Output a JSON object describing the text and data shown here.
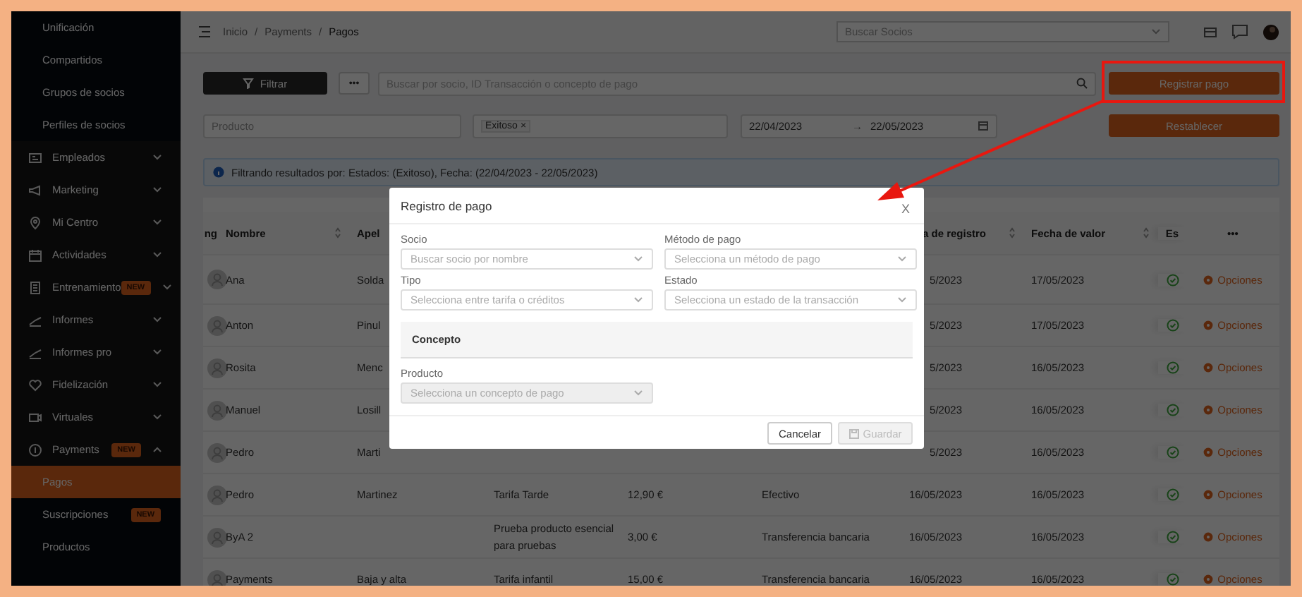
{
  "sidebar": {
    "items": [
      {
        "kind": "subitem",
        "label": "Unificación",
        "selected": false
      },
      {
        "kind": "subitem",
        "label": "Compartidos",
        "selected": false
      },
      {
        "kind": "subitem",
        "label": "Grupos de socios",
        "selected": false
      },
      {
        "kind": "subitem",
        "label": "Perfiles de socios",
        "selected": false
      },
      {
        "kind": "section",
        "label": "Empleados",
        "expanded": false
      },
      {
        "kind": "section",
        "label": "Marketing",
        "expanded": false
      },
      {
        "kind": "section",
        "label": "Mi Centro",
        "expanded": false
      },
      {
        "kind": "section",
        "label": "Actividades",
        "expanded": false
      },
      {
        "kind": "section",
        "label": "Entrenamiento",
        "badge": "NEW",
        "expanded": false
      },
      {
        "kind": "section",
        "label": "Informes",
        "expanded": false
      },
      {
        "kind": "section",
        "label": "Informes pro",
        "expanded": false
      },
      {
        "kind": "section",
        "label": "Fidelización",
        "expanded": false
      },
      {
        "kind": "section",
        "label": "Virtuales",
        "expanded": false
      },
      {
        "kind": "section",
        "label": "Payments",
        "badge": "NEW",
        "expanded": true,
        "children": [
          {
            "kind": "subitem",
            "label": "Pagos",
            "selected": true
          },
          {
            "kind": "subitem",
            "label": "Suscripciones",
            "badge": "NEW",
            "selected": false
          },
          {
            "kind": "subitem",
            "label": "Productos",
            "selected": false
          }
        ]
      }
    ]
  },
  "topbar": {
    "breadcrumb": [
      "Inicio",
      "/",
      "Payments",
      "/",
      "Pagos"
    ],
    "member_search": {
      "placeholder": "Buscar Socios"
    }
  },
  "toolbar": {
    "filter_button": "Filtrar",
    "more_button": "•••",
    "search": {
      "placeholder": "Buscar por socio, ID Transacción o concepto de pago"
    },
    "register_button": "Registrar pago"
  },
  "filters": {
    "product": {
      "placeholder": "Producto"
    },
    "status_tags": [
      {
        "label": "Exitoso",
        "remove": "×"
      }
    ],
    "date_from": "22/04/2023",
    "date_arrow": "→",
    "date_to": "22/05/2023",
    "reset_button": "Restablecer"
  },
  "alert": "Filtrando resultados por: Estados: (Exitoso), Fecha: (22/04/2023 - 22/05/2023)",
  "table": {
    "columns": [
      {
        "label": "ng",
        "sortable": false
      },
      {
        "label": "Nombre",
        "sortable": true
      },
      {
        "label": "Apel",
        "sortable": false
      },
      {
        "label": "a de registro",
        "sortable": true
      },
      {
        "label": "Fecha de valor",
        "sortable": true
      },
      {
        "label": "Es",
        "sortable": false
      },
      {
        "label": "•••",
        "sortable": false
      }
    ],
    "rows": [
      {
        "nombre": "Ana",
        "apellido": "Solda",
        "fecha_registro": "5/2023",
        "fecha_valor": "17/05/2023",
        "action": "Opciones"
      },
      {
        "nombre": "Anton",
        "apellido": "Pinul",
        "fecha_registro": "5/2023",
        "fecha_valor": "17/05/2023",
        "action": "Opciones"
      },
      {
        "nombre": "Rosita",
        "apellido": "Menc",
        "fecha_registro": "5/2023",
        "fecha_valor": "16/05/2023",
        "action": "Opciones"
      },
      {
        "nombre": "Manuel",
        "apellido": "Losill",
        "fecha_registro": "5/2023",
        "fecha_valor": "16/05/2023",
        "action": "Opciones"
      },
      {
        "nombre": "Pedro",
        "apellido": "Marti",
        "fecha_registro": "5/2023",
        "fecha_valor": "16/05/2023",
        "action": "Opciones"
      },
      {
        "nombre": "Pedro",
        "apellido": "Martinez",
        "concepto": "Tarifa Tarde",
        "importe": "12,90 €",
        "metodo": "Efectivo",
        "fecha_registro": "16/05/2023",
        "fecha_valor": "16/05/2023",
        "action": "Opciones"
      },
      {
        "nombre": "ByA 2",
        "concepto": "Prueba producto esencial para pruebas",
        "importe": "3,00 €",
        "metodo": "Transferencia bancaria",
        "fecha_registro": "16/05/2023",
        "fecha_valor": "16/05/2023",
        "action": "Opciones"
      },
      {
        "nombre": "Payments",
        "apellido": "Baja y alta",
        "concepto": "Tarifa infantil",
        "importe": "15,00 €",
        "metodo": "Transferencia bancaria",
        "fecha_registro": "16/05/2023",
        "fecha_valor": "16/05/2023",
        "action": "Opciones"
      }
    ]
  },
  "modal": {
    "title": "Registro de pago",
    "close": "X",
    "fields": [
      {
        "label": "Socio",
        "placeholder": "Buscar socio por nombre",
        "disabled": false
      },
      {
        "label": "Método de pago",
        "placeholder": "Selecciona un método de pago",
        "disabled": false
      },
      {
        "label": "Tipo",
        "placeholder": "Selecciona entre tarifa o créditos",
        "disabled": false
      },
      {
        "label": "Estado",
        "placeholder": "Selecciona un estado de la transacción",
        "disabled": false
      }
    ],
    "section_title": "Concepto",
    "product_field": {
      "label": "Producto",
      "placeholder": "Selecciona un concepto de pago",
      "disabled": true
    },
    "buttons": [
      {
        "label": "Cancelar",
        "disabled": false
      },
      {
        "label": "Guardar",
        "disabled": true
      }
    ]
  }
}
